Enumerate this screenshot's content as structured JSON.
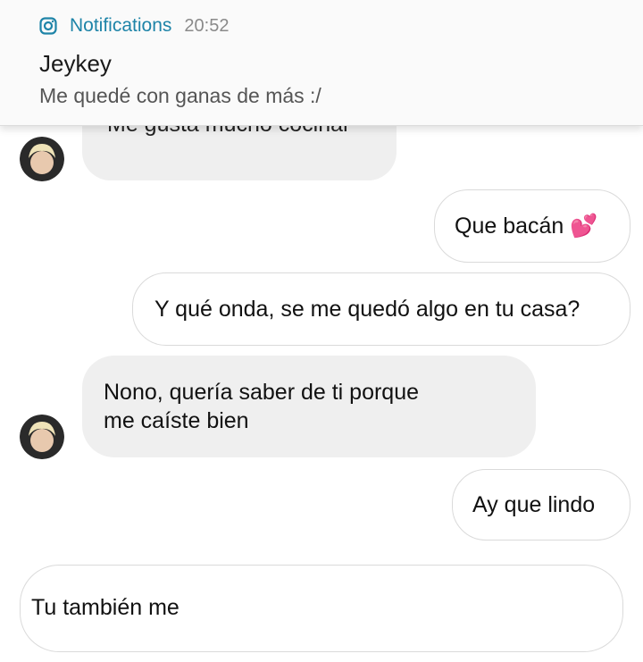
{
  "notification": {
    "app_name": "Notifications",
    "time": "20:52",
    "title": "Jeykey",
    "body": "Me quedé con ganas de más :/",
    "icon": "instagram-icon"
  },
  "messages": [
    {
      "from": "them",
      "text": "Me gusta mucho cocinar"
    },
    {
      "from": "me",
      "text": "Que bacán 💕"
    },
    {
      "from": "me",
      "text": "Y qué onda, se me quedó algo en tu casa?"
    },
    {
      "from": "them",
      "line1": "Nono, quería saber de ti porque",
      "line2": "me caíste bien"
    },
    {
      "from": "me",
      "text": "Ay que lindo"
    }
  ],
  "composer": {
    "value": "Tu también me"
  },
  "colors": {
    "accent": "#1e84a8",
    "incoming_bubble": "#efefef",
    "outgoing_border": "#dadada"
  }
}
